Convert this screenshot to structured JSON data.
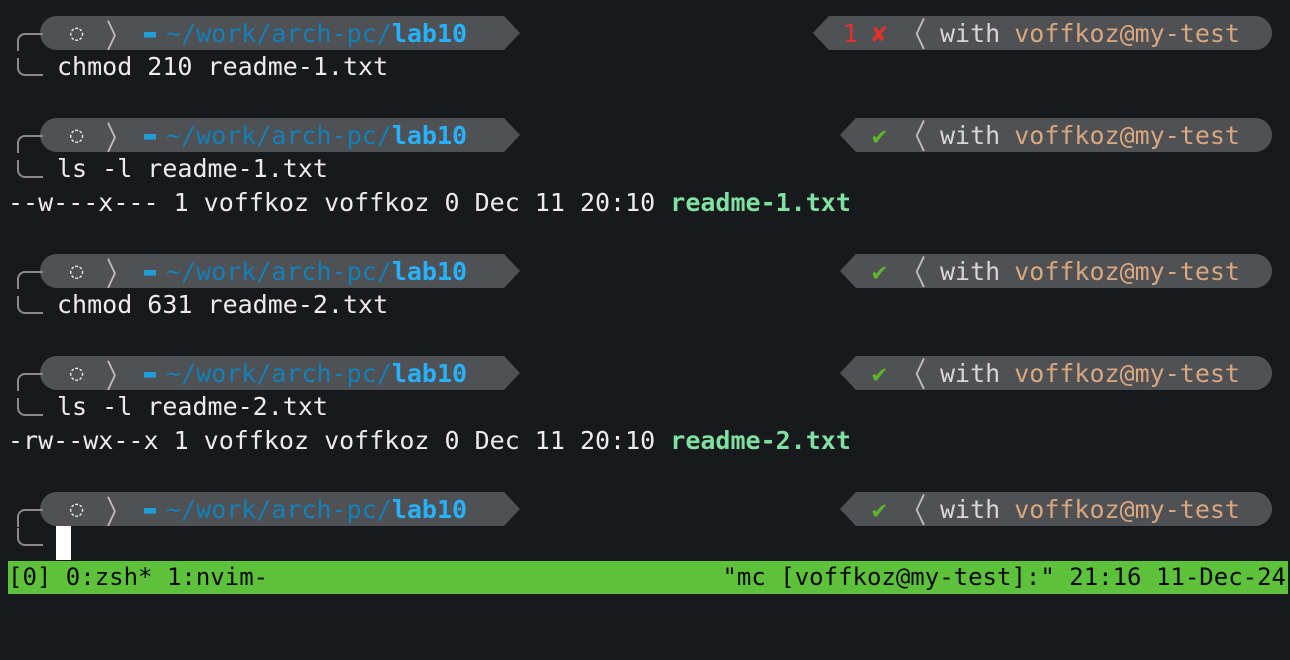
{
  "prompt": {
    "os_icon": "ubuntu-icon",
    "separator": "〉",
    "folder_icon": "folder-icon",
    "path_dim": "~/work/arch-pc/",
    "path_last": "lab10",
    "right_separator": "〈",
    "with_label": "with",
    "user_host": "voffkoz@my-test",
    "error_code": "1",
    "error_mark": "✘",
    "ok_mark": "✔"
  },
  "history": [
    {
      "status": "error",
      "command": "chmod 210 readme-1.txt",
      "output": null
    },
    {
      "status": "ok",
      "command": "ls -l readme-1.txt",
      "output": {
        "perms_text": "--w---x--- 1 voffkoz voffkoz 0 Dec 11 20:10 ",
        "filename": "readme-1.txt"
      }
    },
    {
      "status": "ok",
      "command": "chmod 631 readme-2.txt",
      "output": null
    },
    {
      "status": "ok",
      "command": "ls -l readme-2.txt",
      "output": {
        "perms_text": "-rw--wx--x 1 voffkoz voffkoz 0 Dec 11 20:10 ",
        "filename": "readme-2.txt"
      }
    },
    {
      "status": "ok",
      "command": "",
      "output": null
    }
  ],
  "tmux": {
    "left": "[0] 0:zsh* 1:nvim-",
    "right": "\"mc [voffkoz@my-test]:\" 21:16 11-Dec-24"
  },
  "colors": {
    "background": "#17191d",
    "segment": "#4f5155",
    "path": "#27b2ff",
    "error": "#e0312d",
    "ok": "#5eb52a",
    "user": "#d9a77e",
    "filename": "#7fe0a0",
    "tmux_bar": "#5ec13c"
  }
}
